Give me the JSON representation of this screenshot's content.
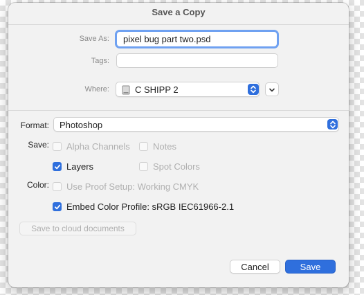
{
  "dialog": {
    "title": "Save a Copy"
  },
  "save_as": {
    "label": "Save As:",
    "value": "pixel bug part two.psd"
  },
  "tags": {
    "label": "Tags:",
    "value": ""
  },
  "where": {
    "label": "Where:",
    "value": "C SHIPP 2",
    "icon": "drive-icon"
  },
  "format": {
    "label": "Format:",
    "value": "Photoshop"
  },
  "save_options": {
    "label": "Save:",
    "alpha_channels": {
      "label": "Alpha Channels",
      "checked": false,
      "enabled": false
    },
    "notes": {
      "label": "Notes",
      "checked": false,
      "enabled": false
    },
    "layers": {
      "label": "Layers",
      "checked": true,
      "enabled": true
    },
    "spot_colors": {
      "label": "Spot Colors",
      "checked": false,
      "enabled": false
    }
  },
  "color_options": {
    "label": "Color:",
    "use_proof_setup": {
      "label": "Use Proof Setup:  Working CMYK",
      "checked": false,
      "enabled": false
    },
    "embed_color_profile": {
      "label": "Embed Color Profile:  sRGB IEC61966-2.1",
      "checked": true,
      "enabled": true
    }
  },
  "buttons": {
    "cloud": "Save to cloud documents",
    "cancel": "Cancel",
    "save": "Save"
  },
  "colors": {
    "accent": "#2f6fdd",
    "focus_ring": "#6fa1f1"
  }
}
